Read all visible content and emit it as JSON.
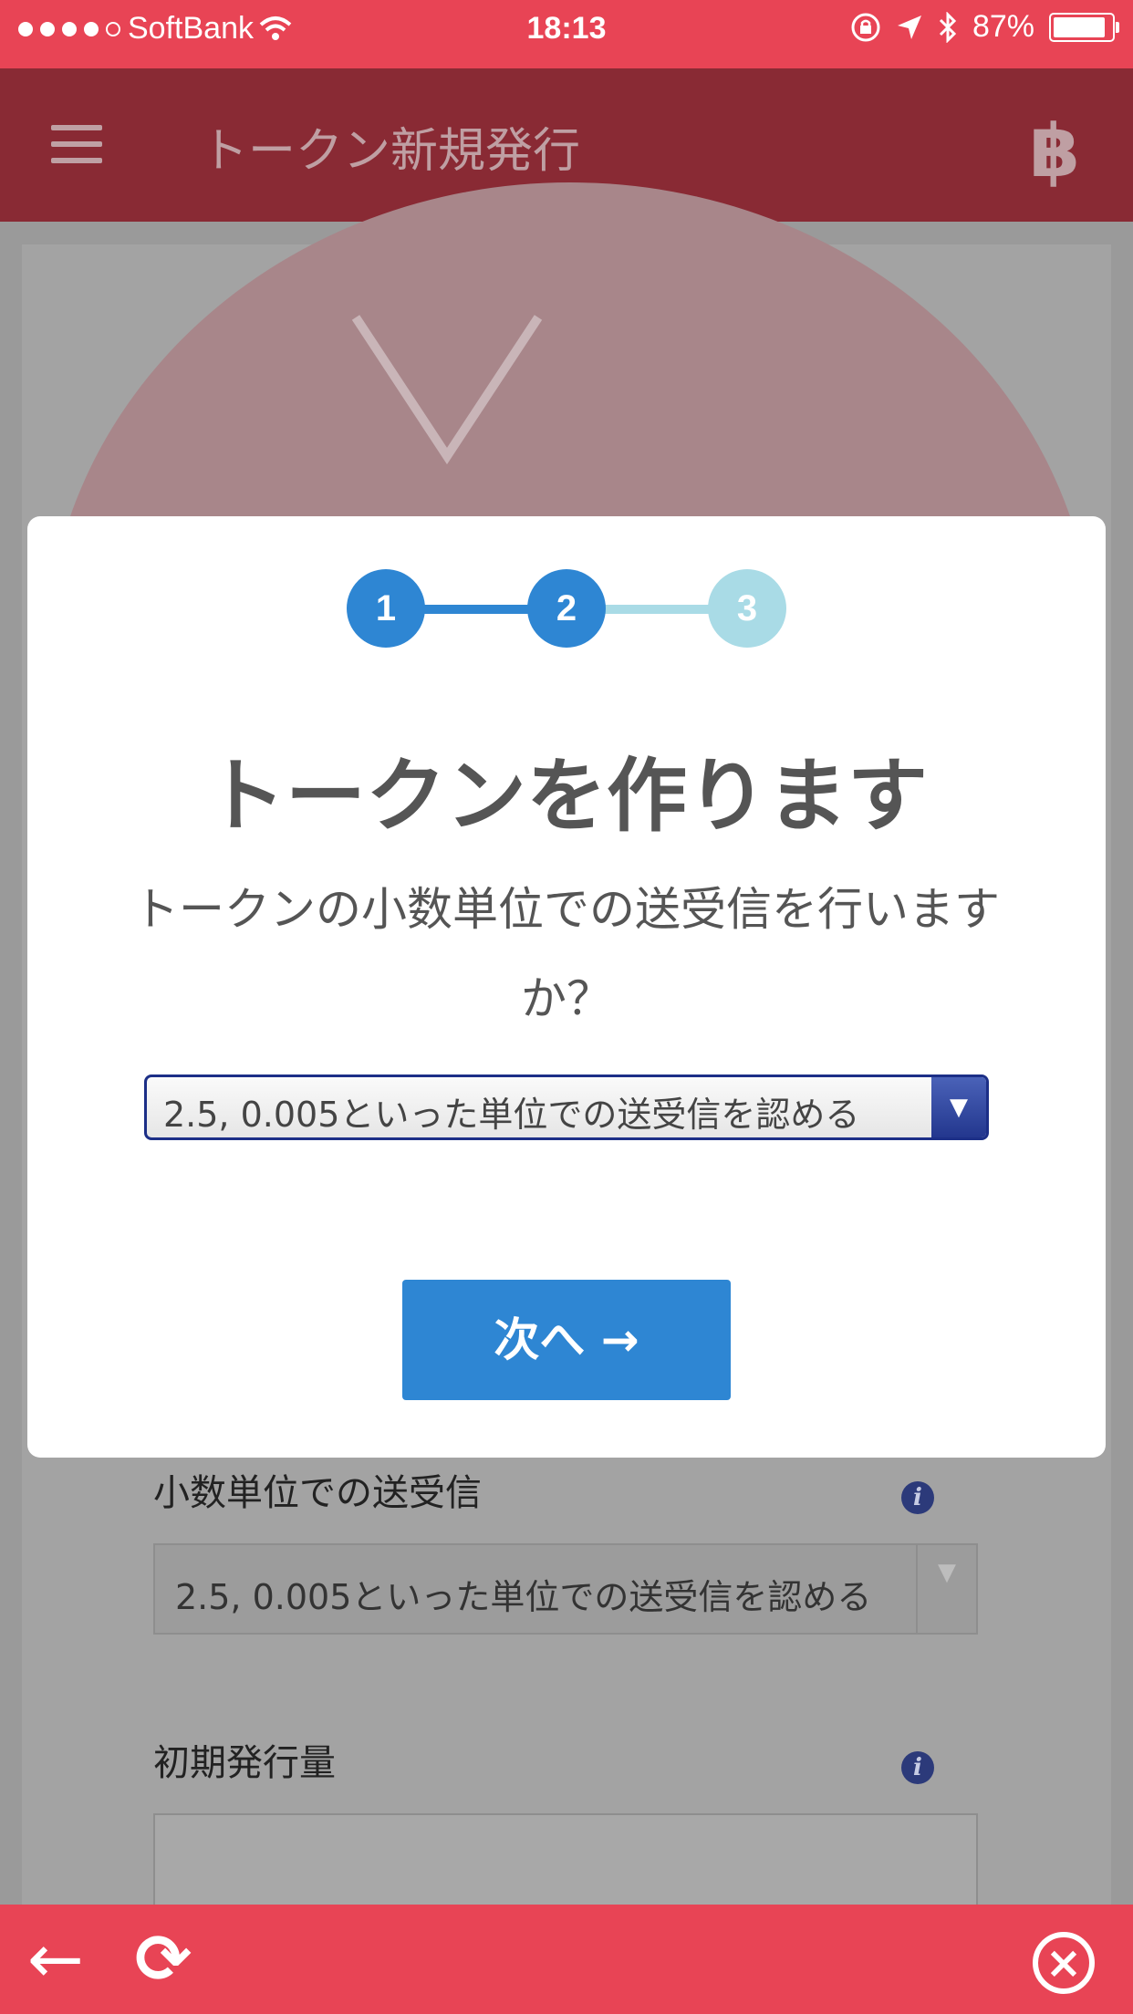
{
  "status_bar": {
    "carrier": "SoftBank",
    "time": "18:13",
    "battery": "87%"
  },
  "app_bar": {
    "title": "トークン新規発行",
    "menu_icon": "hamburger-icon",
    "bitcoin_icon": "฿"
  },
  "background_form": {
    "decimal_label": "小数単位での送受信",
    "decimal_select_value": "2.5, 0.005といった単位での送受信を認める",
    "initial_issue_label": "初期発行量",
    "info_icon": "i"
  },
  "modal": {
    "steps": [
      "1",
      "2",
      "3"
    ],
    "current_step": 2,
    "title": "トークンを作ります",
    "question": "トークンの小数単位での送受信を行いますか？",
    "select_value": "2.5, 0.005といった単位での送受信を認める",
    "next_button": "次へ →"
  },
  "toolbar": {
    "back": "←",
    "refresh": "⟳",
    "close": "×"
  },
  "colors": {
    "status_bar": "#e84455",
    "app_bar": "#892a34",
    "accent_blue": "#2e86d3",
    "step_inactive": "#a9dbe6"
  }
}
